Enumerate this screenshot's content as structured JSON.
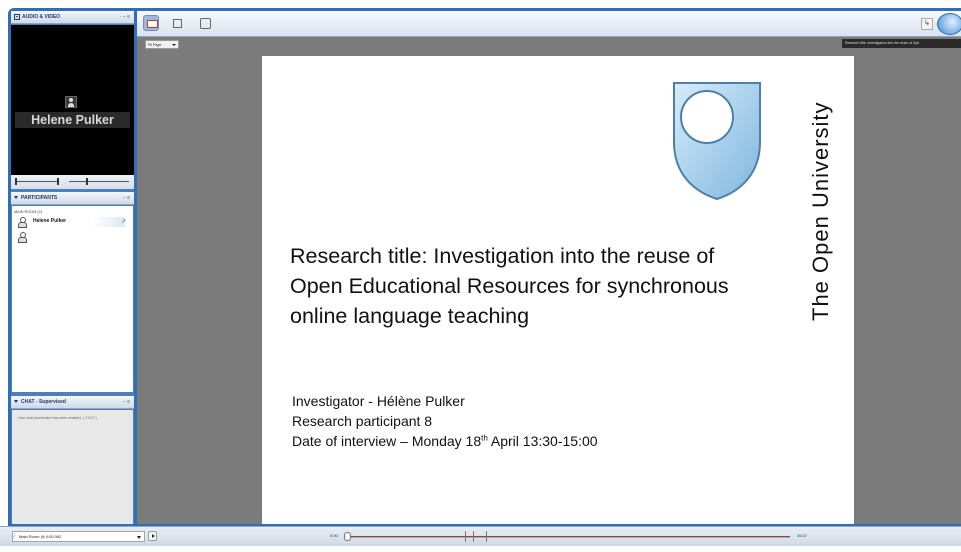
{
  "audio_video": {
    "title": "AUDIO & VIDEO",
    "header_controls": "· – ≡",
    "speaker_name": "Helene Pulker"
  },
  "participants": {
    "title": "PARTICIPANTS",
    "header_controls": "– ≡",
    "room_label": "MAIN ROOM (2)",
    "list": [
      {
        "name": "Helene Pulker",
        "mic": "↗"
      },
      {
        "name": ""
      }
    ]
  },
  "chat": {
    "title": "CHAT - Supervised",
    "header_controls": "– ≡",
    "message": "- Your chat permission has been enabled. ( 17:07 )"
  },
  "toolbar": {
    "fit_select": "Fit Page",
    "content_title": "Research title: Investigation into the reuse of Ope"
  },
  "slide": {
    "org_name": "The Open University",
    "title": "Research title: Investigation into the reuse of Open Educational Resources for synchronous online language teaching",
    "investigator": "Investigator - Hélène Pulker",
    "participant": "Research participant 8",
    "date_prefix": "Date of interview – Monday 18",
    "date_sup": "th",
    "date_suffix": " April 13:30-15:00"
  },
  "statusbar": {
    "room": "Main Room @ 0:00.062",
    "time_start": "0:00",
    "time_end": "45:37",
    "playback_progress": 0.0
  },
  "colors": {
    "frame": "#2f6fb8",
    "logo_blue": "#a9d2ee"
  }
}
